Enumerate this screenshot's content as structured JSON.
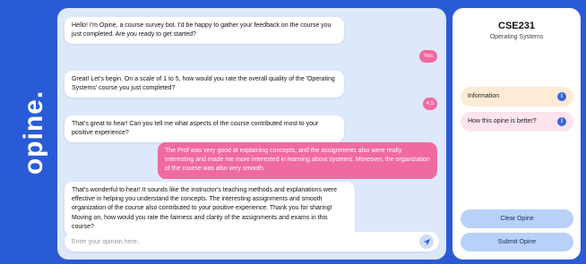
{
  "brand": {
    "logo": "opine."
  },
  "chat": {
    "messages": [
      {
        "text": "Hello! I'm Opine, a course survey bot. I'd be happy to gather your feedback on the course you just completed. Are you ready to get started?"
      },
      {
        "text": "Yes"
      },
      {
        "text": "Great! Let's begin. On a scale of 1 to 5, how would you rate the overall quality of the 'Operating Systems' course you just completed?"
      },
      {
        "text": "4.5"
      },
      {
        "text": "That's great to hear! Can you tell me what aspects of the course contributed most to your positive experience?"
      },
      {
        "text": "The Prof was very good at explaining concepts, and the assignments also were really interesting and made me more interested in learning about systems. Moreover, the organization of the course was also very smooth."
      },
      {
        "text": "That's wonderful to hear! It sounds like the instructor's teaching methods and explanations were effective in helping you understand the concepts. The interesting assignments and smooth organization of the course also contributed to your positive experience. Thank you for sharing! Moving on, how would you rate the fairness and clarity of the assignments and exams in this course?"
      }
    ],
    "input": {
      "placeholder": "Enter your opinion here..",
      "value": ""
    },
    "send_icon": "send-arrow-icon"
  },
  "panel": {
    "course_code": "CSE231",
    "course_name": "Operating Systems",
    "info_items": [
      {
        "label": "Information",
        "color": "#fdebd5",
        "icon": "info-icon"
      },
      {
        "label": "How this opine is better?",
        "color": "#fde4ef",
        "icon": "info-icon"
      }
    ],
    "clear_label": "Clear Opine",
    "submit_label": "Submit Opine"
  },
  "colors": {
    "background": "#2a5bd7",
    "chat_area": "#dde8fb",
    "user_bubble": "#f06aa0",
    "button": "#b9d0f8",
    "accent": "#3a66e0"
  }
}
